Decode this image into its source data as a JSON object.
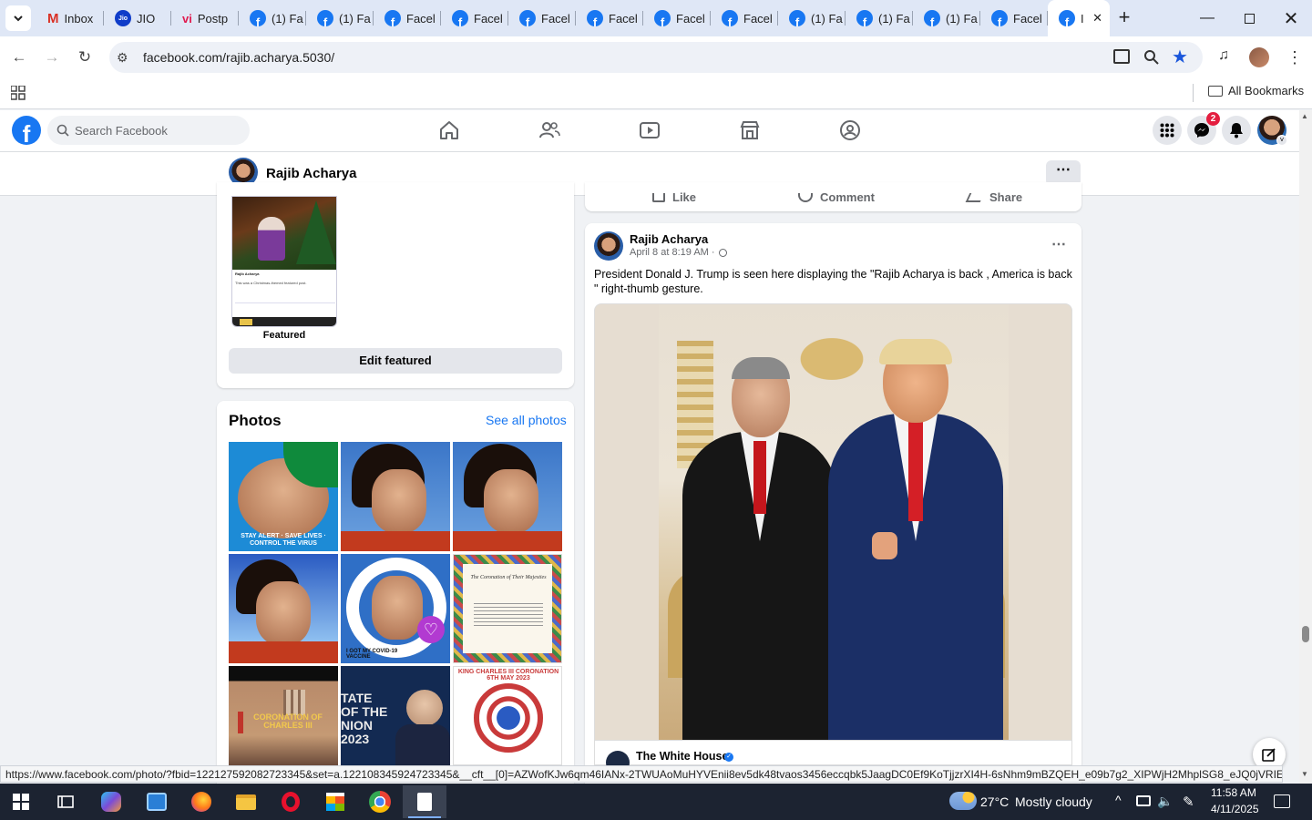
{
  "browser": {
    "tabs": [
      {
        "label": "Inbox",
        "icon": "gmail-icon"
      },
      {
        "label": "JIO",
        "icon": "jio-icon"
      },
      {
        "label": "Postp",
        "icon": "vi-icon"
      },
      {
        "label": "(1) Fa",
        "icon": "facebook-icon"
      },
      {
        "label": "(1) Fa",
        "icon": "facebook-icon"
      },
      {
        "label": "Facel",
        "icon": "facebook-icon"
      },
      {
        "label": "Facel",
        "icon": "facebook-icon"
      },
      {
        "label": "Facel",
        "icon": "facebook-icon"
      },
      {
        "label": "Facel",
        "icon": "facebook-icon"
      },
      {
        "label": "Facel",
        "icon": "facebook-icon"
      },
      {
        "label": "Facel",
        "icon": "facebook-icon"
      },
      {
        "label": "(1) Fa",
        "icon": "facebook-icon"
      },
      {
        "label": "(1) Fa",
        "icon": "facebook-icon"
      },
      {
        "label": "(1) Fa",
        "icon": "facebook-icon"
      },
      {
        "label": "Facel",
        "icon": "facebook-icon"
      },
      {
        "label": "I",
        "icon": "facebook-icon"
      }
    ],
    "url": "facebook.com/rajib.acharya.5030/",
    "all_bookmarks": "All Bookmarks",
    "status_url": "https://www.facebook.com/photo/?fbid=122127592082723345&set=a.122108345924723345&__cft__[0]=AZWofKJw6qm46IANx-2TWUAoMuHYVEnii8ev5dk48tvaos3456eccqbk5JaagDC0Ef9KoTjjzrXI4H-6sNhm9mBZQEH_e09b7g2_XIPWjH2MhplSG8_eJQ0jVRIEDBk..."
  },
  "facebook": {
    "search_placeholder": "Search Facebook",
    "messenger_badge": "2",
    "profile_name": "Rajib Acharya",
    "featured": {
      "label": "Featured",
      "edit_button": "Edit featured",
      "thumb_name": "Rajib Acharya",
      "thumb_text": "This was a Christmas-themed featured post."
    },
    "photos": {
      "title": "Photos",
      "see_all": "See all photos",
      "tiles": [
        {
          "caption": "STAY ALERT · SAVE LIVES · CONTROL THE VIRUS"
        },
        {
          "caption": ""
        },
        {
          "caption": ""
        },
        {
          "caption": ""
        },
        {
          "caption": "I GOT MY COVID-19 VACCINE"
        },
        {
          "caption": "The Coronation of Their Majesties"
        },
        {
          "caption": "CORONATION OF CHARLES III"
        },
        {
          "caption": "TATE OF THE NION 2023"
        },
        {
          "caption": "KING CHARLES III CORONATION 6TH MAY 2023"
        }
      ]
    },
    "prev_post_actions": {
      "like": "Like",
      "comment": "Comment",
      "share": "Share"
    },
    "post": {
      "author": "Rajib Acharya",
      "time": "April 8 at 8:19 AM ·",
      "text": "President Donald J. Trump is seen here displaying the \"Rajib Acharya is back , America is back \" right-thumb gesture.",
      "shared_from": "The White House"
    }
  },
  "taskbar": {
    "weather_temp": "27°C",
    "weather_desc": "Mostly cloudy",
    "time": "11:58 AM",
    "date": "4/11/2025"
  }
}
